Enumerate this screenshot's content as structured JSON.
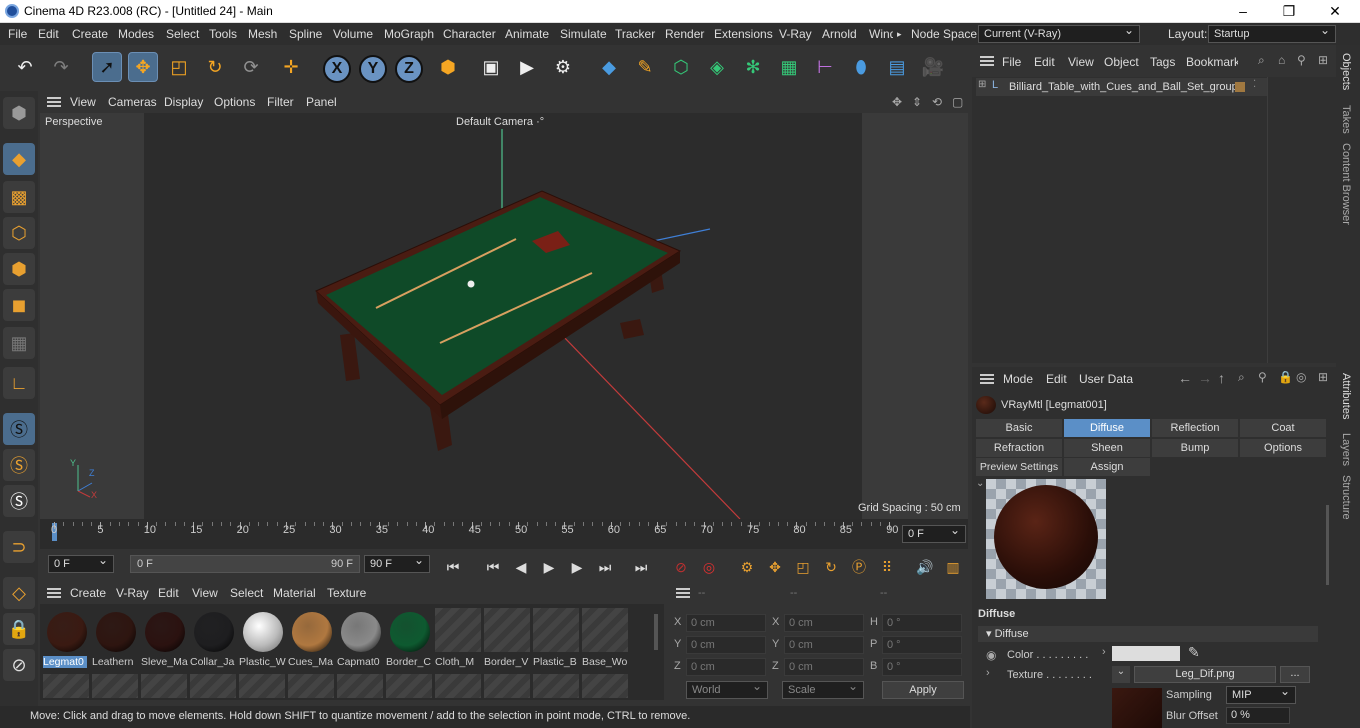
{
  "titlebar": {
    "title": "Cinema 4D R23.008 (RC) - [Untitled 24] - Main",
    "minimize": "–",
    "maximize": "❐",
    "close": "✕"
  },
  "menu": {
    "items": [
      "File",
      "Edit",
      "Create",
      "Modes",
      "Select",
      "Tools",
      "Mesh",
      "Spline",
      "Volume",
      "MoGraph",
      "Character",
      "Animate",
      "Simulate",
      "Tracker",
      "Render",
      "Extensions",
      "V-Ray",
      "Arnold",
      "Wind"
    ],
    "more": "▸",
    "node_space_label": "Node Space:",
    "node_space_value": "Current (V-Ray)",
    "layout_label": "Layout:",
    "layout_value": "Startup"
  },
  "viewport": {
    "menu": [
      "View",
      "Cameras",
      "Display",
      "Options",
      "Filter",
      "Panel"
    ],
    "label": "Perspective",
    "camera": "Default Camera",
    "camera_icon": "·°",
    "grid_spacing": "Grid Spacing : 50 cm",
    "axis_y": "Y",
    "axis_z": "Z",
    "axis_x": "X"
  },
  "timeline": {
    "ticks": [
      "0",
      "5",
      "10",
      "15",
      "20",
      "25",
      "30",
      "35",
      "40",
      "45",
      "50",
      "55",
      "60",
      "65",
      "70",
      "75",
      "80",
      "85",
      "90"
    ],
    "current_frame": "0 F"
  },
  "transport": {
    "start": "0 F",
    "range_start": "0 F",
    "range_end": "90 F",
    "end": "90 F"
  },
  "materials": {
    "menu": [
      "Create",
      "V-Ray",
      "Edit",
      "View",
      "Select",
      "Material",
      "Texture"
    ],
    "items": [
      {
        "label": "Legmat0",
        "color": "#3a1a12"
      },
      {
        "label": "Leathern",
        "color": "#2e1510"
      },
      {
        "label": "Sleve_Ma",
        "color": "#2b1210"
      },
      {
        "label": "Collar_Ja",
        "color": "#1e1e20"
      },
      {
        "label": "Plastic_W",
        "color": "#d8d8d8"
      },
      {
        "label": "Cues_Ma",
        "color": "#b07840"
      },
      {
        "label": "Capmat0",
        "color": "#8a8a8a"
      },
      {
        "label": "Border_C",
        "color": "#0e5a30"
      },
      {
        "label": "Cloth_M",
        "color": ""
      },
      {
        "label": "Border_V",
        "color": ""
      },
      {
        "label": "Plastic_B",
        "color": ""
      },
      {
        "label": "Base_Wo",
        "color": ""
      }
    ]
  },
  "coords": {
    "headers": [
      "--",
      "--",
      "--"
    ],
    "rows": [
      {
        "a": "X",
        "av": "0 cm",
        "b": "X",
        "bv": "0 cm",
        "c": "H",
        "cv": "0 °"
      },
      {
        "a": "Y",
        "av": "0 cm",
        "b": "Y",
        "bv": "0 cm",
        "c": "P",
        "cv": "0 °"
      },
      {
        "a": "Z",
        "av": "0 cm",
        "b": "Z",
        "bv": "0 cm",
        "c": "B",
        "cv": "0 °"
      }
    ],
    "world": "World",
    "scale": "Scale",
    "apply": "Apply"
  },
  "status": "Move: Click and drag to move elements. Hold down SHIFT to quantize movement / add to the selection in point mode, CTRL to remove.",
  "objects": {
    "menu": [
      "File",
      "Edit",
      "View",
      "Object",
      "Tags",
      "Bookmarks"
    ],
    "tree_item": "Billiard_Table_with_Cues_and_Ball_Set_group"
  },
  "attributes": {
    "menu": [
      "Mode",
      "Edit",
      "User Data"
    ],
    "material_name": "VRayMtl [Legmat001]",
    "tabs_row1": [
      "Basic",
      "Diffuse",
      "Reflection",
      "Coat"
    ],
    "tabs_row2": [
      "Refraction",
      "Sheen",
      "Bump",
      "Options"
    ],
    "tabs_row3": [
      "Preview Settings",
      "Assign"
    ],
    "section": "Diffuse",
    "subsection": "Diffuse",
    "color_label": "Color . . . . . . . . .",
    "texture_label": "Texture . . . . . . . .",
    "texture_file": "Leg_Dif.png",
    "texture_more": "...",
    "sampling_label": "Sampling",
    "sampling_value": "MIP",
    "blur_label": "Blur Offset",
    "blur_value": "0 %"
  },
  "sidetabs": {
    "objects": "Objects",
    "takes": "Takes",
    "content": "Content Browser",
    "attributes": "Attributes",
    "layers": "Layers",
    "structure": "Structure"
  }
}
